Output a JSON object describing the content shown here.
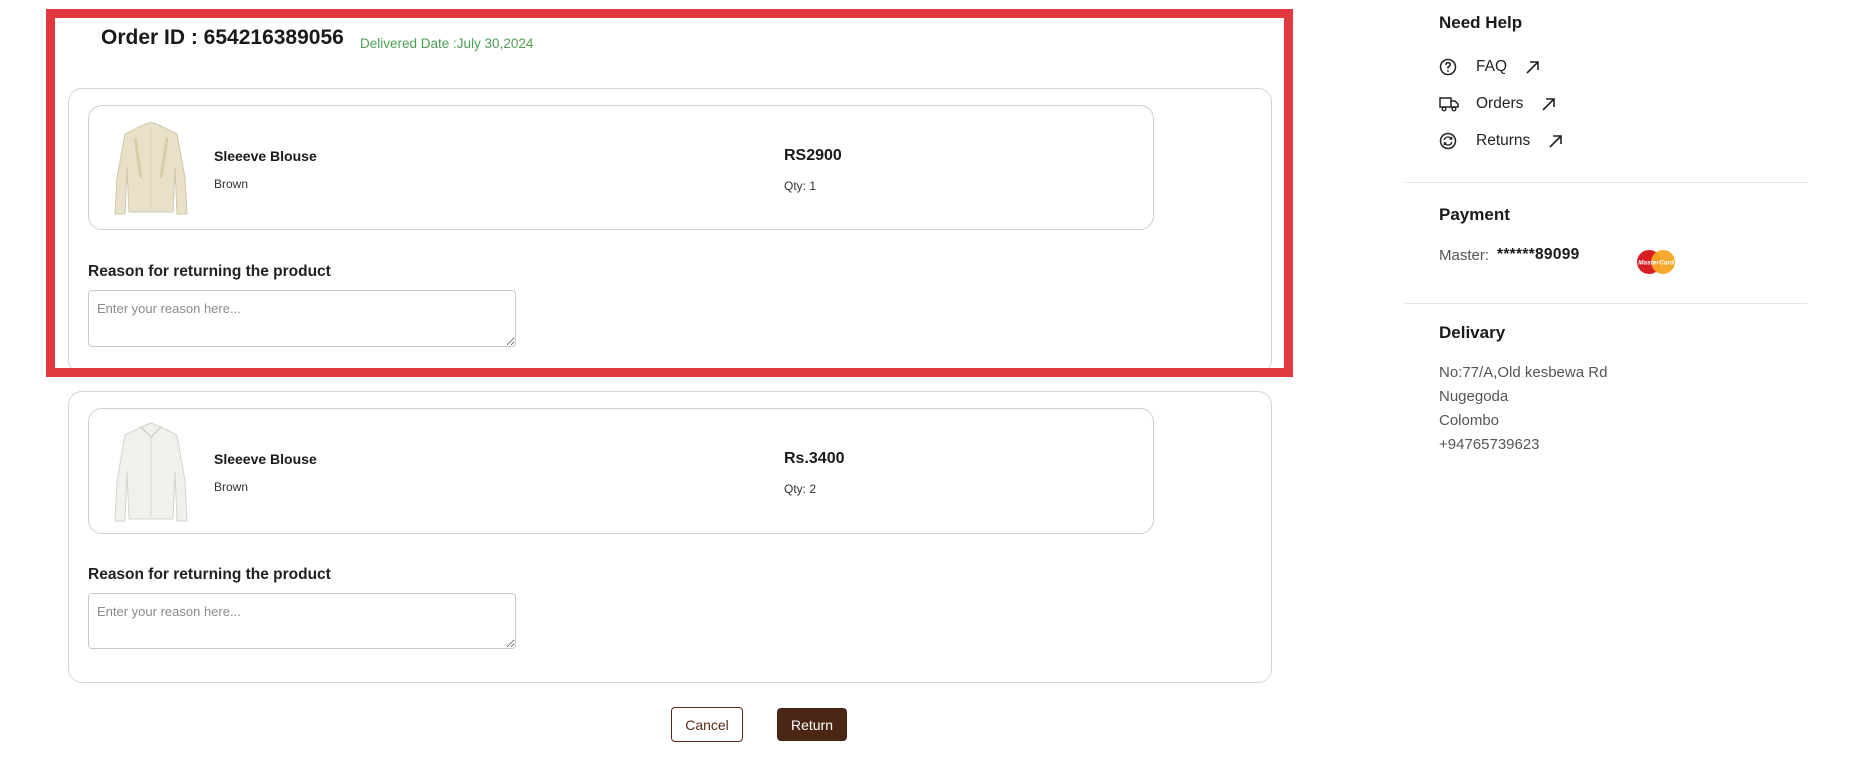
{
  "order": {
    "title": "Order ID : 654216389056",
    "delivered": "Delivered Date :July 30,2024"
  },
  "items": [
    {
      "name": "Sleeeve Blouse",
      "color": "Brown",
      "price": "RS2900",
      "qty": "Qty: 1",
      "reason_label": "Reason for returning the product",
      "reason_placeholder": "Enter your reason here...",
      "reason_value": ""
    },
    {
      "name": "Sleeeve Blouse",
      "color": "Brown",
      "price": "Rs.3400",
      "qty": "Qty: 2",
      "reason_label": "Reason for returning the product",
      "reason_placeholder": "Enter your reason here...",
      "reason_value": ""
    }
  ],
  "actions": {
    "cancel": "Cancel",
    "return": "Return"
  },
  "sidebar": {
    "help": {
      "title": "Need Help",
      "links": [
        {
          "label": "FAQ",
          "icon": "question-circle-icon"
        },
        {
          "label": "Orders",
          "icon": "truck-icon"
        },
        {
          "label": "Returns",
          "icon": "return-circle-icon"
        }
      ],
      "link_icon": "arrow-up-right-icon"
    },
    "payment": {
      "title": "Payment",
      "method_label": "Master:",
      "card_number": "******89099",
      "card_brand": "MasterCard"
    },
    "delivery": {
      "title": "Delivary",
      "address_line1": "No:77/A,Old kesbewa Rd",
      "address_line2": "Nugegoda",
      "address_line3": "Colombo",
      "phone": "+94765739623"
    }
  },
  "colors": {
    "highlight": "#e1393f",
    "delivered_green": "#4f9e55",
    "brand_brown": "#4b2614"
  }
}
